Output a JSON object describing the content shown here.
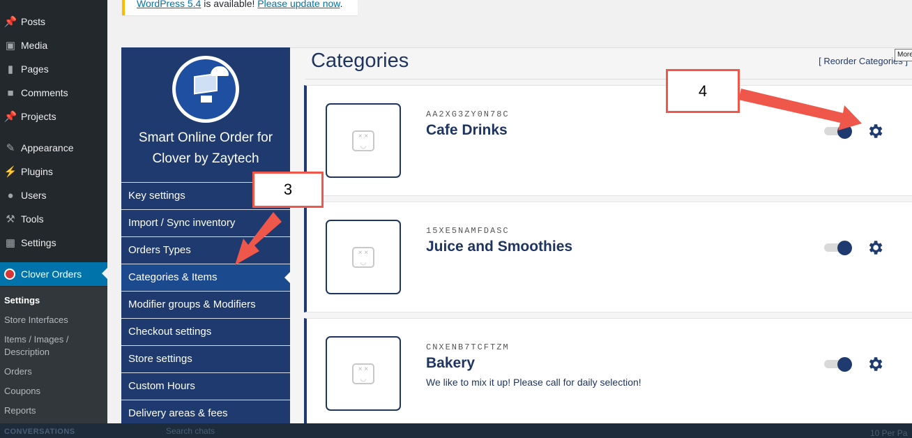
{
  "notice": {
    "link1": "WordPress 5.4",
    "text": " is available! ",
    "link2": "Please update now",
    "end": "."
  },
  "wp_menu": [
    {
      "label": "Posts",
      "icon": "pin-icon"
    },
    {
      "label": "Media",
      "icon": "media-icon"
    },
    {
      "label": "Pages",
      "icon": "pages-icon"
    },
    {
      "label": "Comments",
      "icon": "comments-icon"
    },
    {
      "label": "Projects",
      "icon": "pin-icon"
    },
    {
      "label": "Appearance",
      "icon": "brush-icon"
    },
    {
      "label": "Plugins",
      "icon": "plug-icon"
    },
    {
      "label": "Users",
      "icon": "user-icon"
    },
    {
      "label": "Tools",
      "icon": "wrench-icon"
    },
    {
      "label": "Settings",
      "icon": "settings-icon"
    },
    {
      "label": "Clover Orders",
      "icon": "clover-logo"
    }
  ],
  "wp_submenu": [
    "Settings",
    "Store Interfaces",
    "Items / Images / Description",
    "Orders",
    "Coupons",
    "Reports"
  ],
  "plugin": {
    "title_line1": "Smart Online Order for",
    "title_line2": "Clover by Zaytech",
    "nav": [
      "Key settings",
      "Import / Sync inventory",
      "Orders Types",
      "Categories & Items",
      "Modifier groups & Modifiers",
      "Checkout settings",
      "Store settings",
      "Custom Hours",
      "Delivery areas & fees"
    ]
  },
  "page": {
    "title": "Categories",
    "reorder": "[ Reorder Categories ]",
    "tooltip": "More"
  },
  "categories": [
    {
      "code": "AA2XG3ZY0N78C",
      "name": "Cafe Drinks",
      "desc": "",
      "enabled": true
    },
    {
      "code": "15XE5NAMFDASC",
      "name": "Juice and Smoothies",
      "desc": "",
      "enabled": true
    },
    {
      "code": "CNXENB7TCFTZM",
      "name": "Bakery",
      "desc": "We like to mix it up! Please call for daily selection!",
      "enabled": true
    }
  ],
  "annotations": {
    "step3": "3",
    "step4": "4"
  },
  "bottom": {
    "conversations": "CONVERSATIONS",
    "search": "Search chats",
    "per_page": "10 Per Pa"
  },
  "colors": {
    "accent": "#1e3a6e",
    "wp_active": "#0073aa",
    "callout": "#f0574b",
    "sidebar": "#23282d"
  }
}
